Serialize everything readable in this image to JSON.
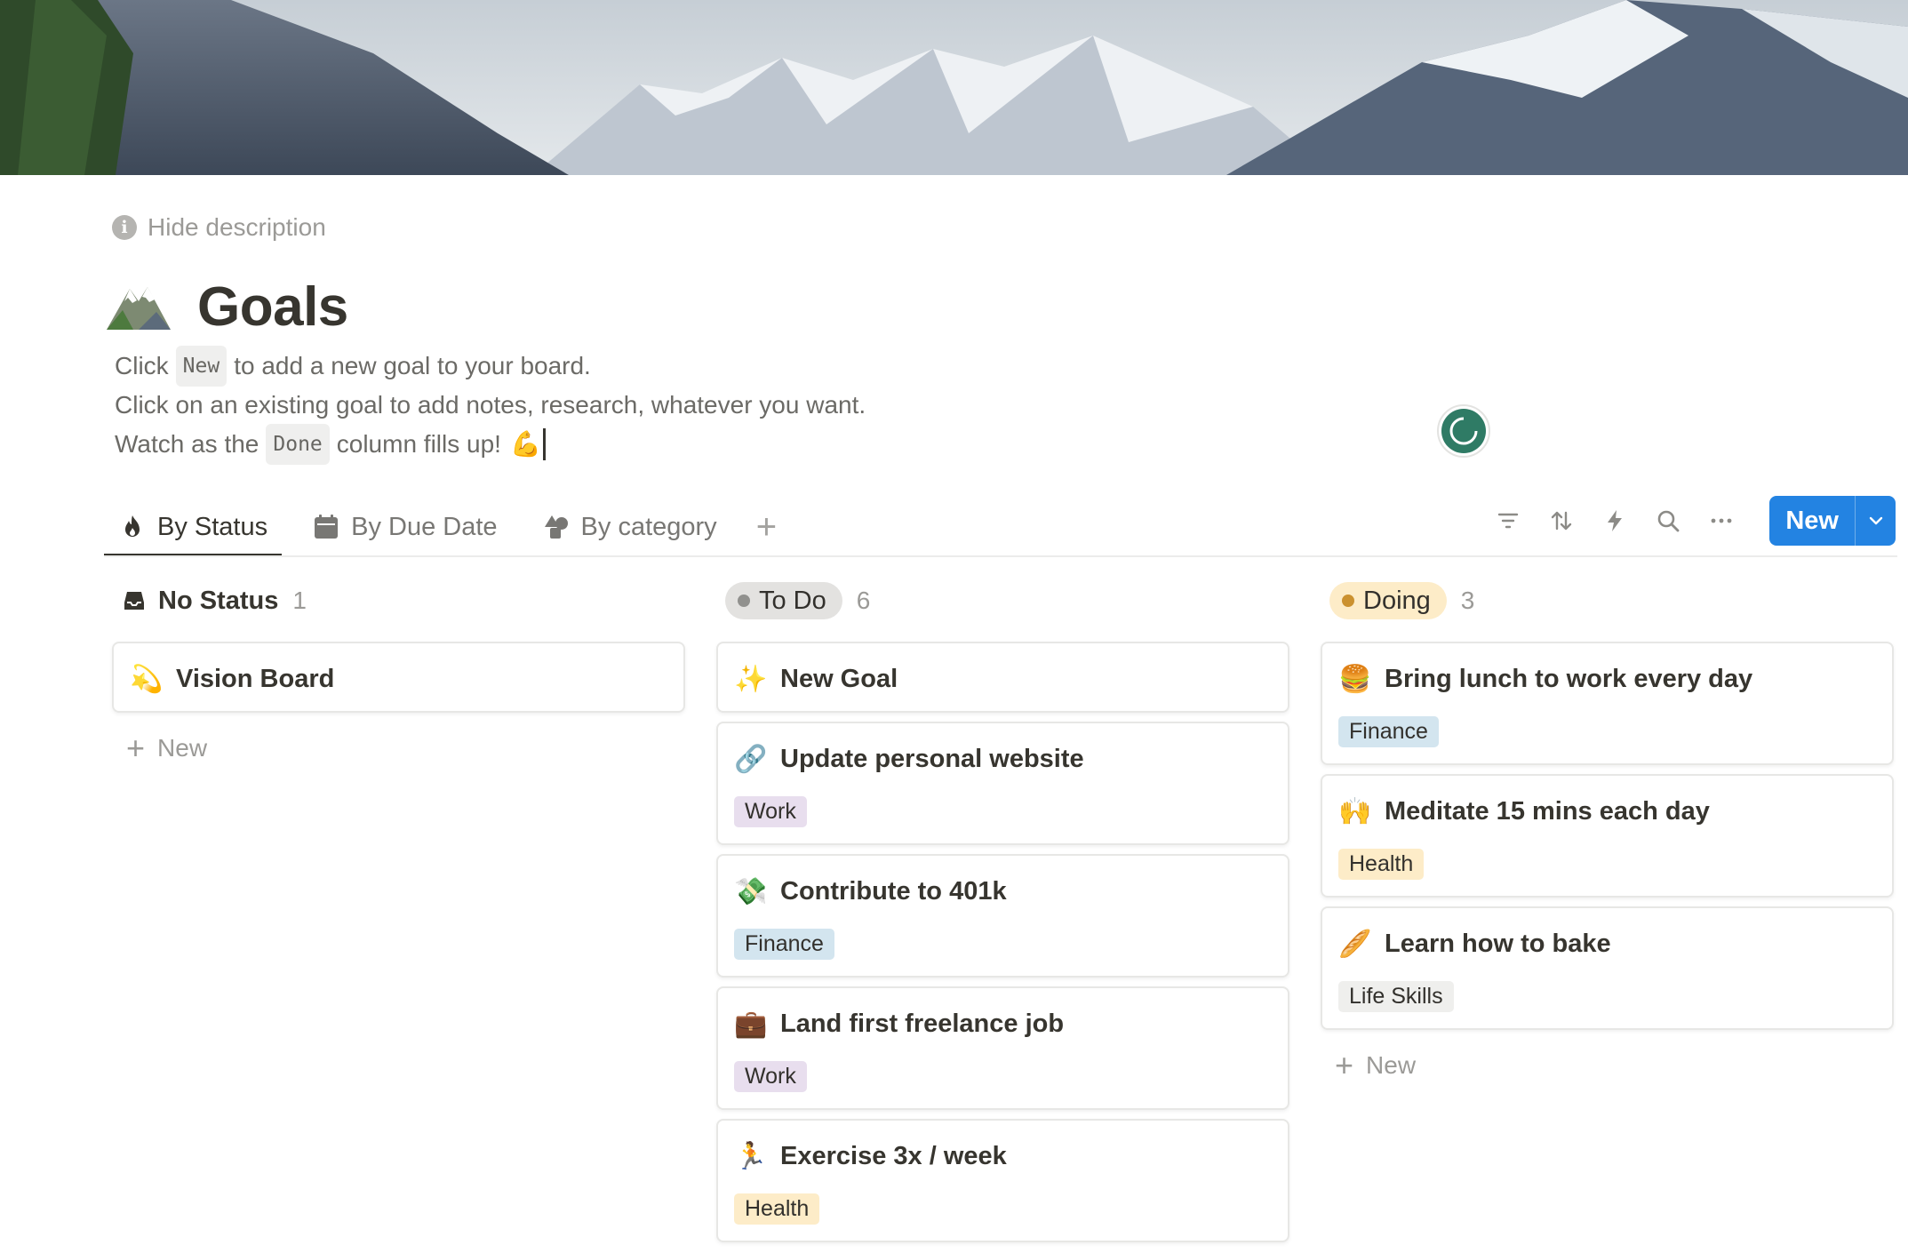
{
  "header": {
    "hide_description": "Hide description",
    "title": "Goals"
  },
  "description": {
    "line1_prefix": "Click",
    "line1_code": "New",
    "line1_suffix": "to add a new goal to your board.",
    "line2": "Click on an existing goal to add notes, research, whatever you want.",
    "line3_prefix": "Watch as the",
    "line3_code": "Done",
    "line3_suffix": "column fills up!",
    "line3_emoji": "💪"
  },
  "tabs": [
    {
      "label": "By Status",
      "icon": "fire-icon"
    },
    {
      "label": "By Due Date",
      "icon": "calendar-icon"
    },
    {
      "label": "By category",
      "icon": "shapes-icon"
    }
  ],
  "toolbar": {
    "icons": [
      "filter-icon",
      "sort-icon",
      "automation-icon",
      "search-icon",
      "more-icon"
    ],
    "new_label": "New"
  },
  "colors": {
    "accent": "#2383e2",
    "todo_pill": "#e3e2e0",
    "todo_dot": "#91918e",
    "doing_pill": "#fdecc8",
    "doing_dot": "#cb912f"
  },
  "columns": [
    {
      "title": "No Status",
      "count": "1",
      "cards": [
        {
          "emoji": "💫",
          "title": "Vision Board"
        }
      ],
      "add_label": "New"
    },
    {
      "title": "To Do",
      "count": "6",
      "cards": [
        {
          "emoji": "✨",
          "title": "New Goal"
        },
        {
          "emoji": "🔗",
          "title": "Update personal website",
          "tag": "Work"
        },
        {
          "emoji": "💸",
          "title": "Contribute to 401k",
          "tag": "Finance"
        },
        {
          "emoji": "💼",
          "title": "Land first freelance job",
          "tag": "Work"
        },
        {
          "emoji": "🏃",
          "title": "Exercise 3x / week",
          "tag": "Health"
        }
      ]
    },
    {
      "title": "Doing",
      "count": "3",
      "cards": [
        {
          "emoji": "🍔",
          "title": "Bring lunch to work every day",
          "tag": "Finance"
        },
        {
          "emoji": "🙌",
          "title": "Meditate 15 mins each day",
          "tag": "Health"
        },
        {
          "emoji": "🥖",
          "title": "Learn how to bake",
          "tag": "Life Skills"
        }
      ],
      "add_label": "New"
    }
  ]
}
